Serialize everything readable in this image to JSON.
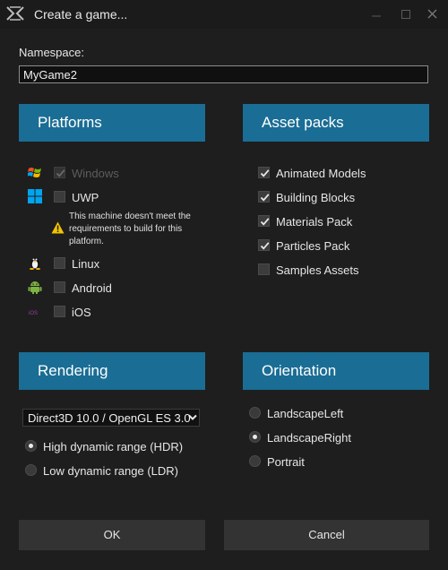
{
  "window": {
    "title": "Create a game..."
  },
  "namespace": {
    "label": "Namespace:",
    "value": "MyGame2"
  },
  "platforms": {
    "header": "Platforms",
    "items": [
      {
        "label": "Windows",
        "checked": true,
        "disabled": true,
        "icon": "windows-icon"
      },
      {
        "label": "UWP",
        "checked": false,
        "disabled": false,
        "icon": "uwp-icon"
      },
      {
        "label": "Linux",
        "checked": false,
        "disabled": false,
        "icon": "linux-icon"
      },
      {
        "label": "Android",
        "checked": false,
        "disabled": false,
        "icon": "android-icon"
      },
      {
        "label": "iOS",
        "checked": false,
        "disabled": false,
        "icon": "ios-icon"
      }
    ],
    "uwp_warning": "This machine doesn't meet the requirements to build for this platform."
  },
  "asset_packs": {
    "header": "Asset packs",
    "items": [
      {
        "label": "Animated Models",
        "checked": true
      },
      {
        "label": "Building Blocks",
        "checked": true
      },
      {
        "label": "Materials Pack",
        "checked": true
      },
      {
        "label": "Particles Pack",
        "checked": true
      },
      {
        "label": "Samples Assets",
        "checked": false
      }
    ]
  },
  "rendering": {
    "header": "Rendering",
    "api_selected": "Direct3D 10.0 / OpenGL ES 3.0",
    "options": [
      {
        "label": "High dynamic range (HDR)",
        "selected": true
      },
      {
        "label": "Low dynamic range (LDR)",
        "selected": false
      }
    ]
  },
  "orientation": {
    "header": "Orientation",
    "options": [
      {
        "label": "LandscapeLeft",
        "selected": false
      },
      {
        "label": "LandscapeRight",
        "selected": true
      },
      {
        "label": "Portrait",
        "selected": false
      }
    ]
  },
  "buttons": {
    "ok": "OK",
    "cancel": "Cancel"
  },
  "colors": {
    "header_bg": "#1a6d94",
    "background": "#1e1e1e",
    "button_bg": "#333333",
    "warning": "#f2c200"
  }
}
